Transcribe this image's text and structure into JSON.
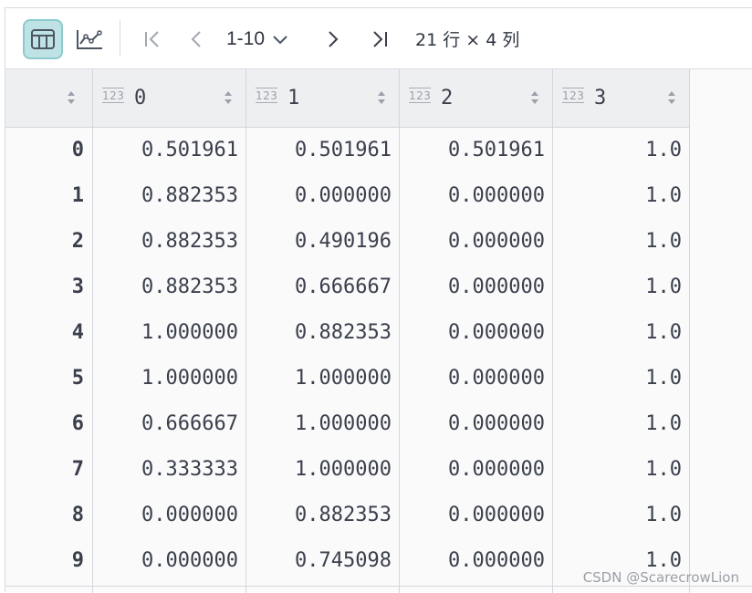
{
  "toolbar": {
    "table_view_icon": "table-icon",
    "chart_view_icon": "line-chart-icon",
    "first_icon": "first-page-icon",
    "prev_icon": "chevron-left-icon",
    "range_label": "1-10",
    "range_dropdown_icon": "chevron-down-icon",
    "next_icon": "chevron-right-icon",
    "last_icon": "last-page-icon",
    "count_label": "21 行 × 4 列",
    "active_color": "#bfe3e4"
  },
  "table": {
    "columns": [
      {
        "type": "123",
        "name": "0"
      },
      {
        "type": "123",
        "name": "1"
      },
      {
        "type": "123",
        "name": "2"
      },
      {
        "type": "123",
        "name": "3"
      }
    ],
    "rows": [
      {
        "index": "0",
        "values": [
          "0.501961",
          "0.501961",
          "0.501961",
          "1.0"
        ]
      },
      {
        "index": "1",
        "values": [
          "0.882353",
          "0.000000",
          "0.000000",
          "1.0"
        ]
      },
      {
        "index": "2",
        "values": [
          "0.882353",
          "0.490196",
          "0.000000",
          "1.0"
        ]
      },
      {
        "index": "3",
        "values": [
          "0.882353",
          "0.666667",
          "0.000000",
          "1.0"
        ]
      },
      {
        "index": "4",
        "values": [
          "1.000000",
          "0.882353",
          "0.000000",
          "1.0"
        ]
      },
      {
        "index": "5",
        "values": [
          "1.000000",
          "1.000000",
          "0.000000",
          "1.0"
        ]
      },
      {
        "index": "6",
        "values": [
          "0.666667",
          "1.000000",
          "0.000000",
          "1.0"
        ]
      },
      {
        "index": "7",
        "values": [
          "0.333333",
          "1.000000",
          "0.000000",
          "1.0"
        ]
      },
      {
        "index": "8",
        "values": [
          "0.000000",
          "0.882353",
          "0.000000",
          "1.0"
        ]
      },
      {
        "index": "9",
        "values": [
          "0.000000",
          "0.745098",
          "0.000000",
          "1.0"
        ]
      }
    ]
  },
  "watermark": "CSDN @ScarecrowLion"
}
